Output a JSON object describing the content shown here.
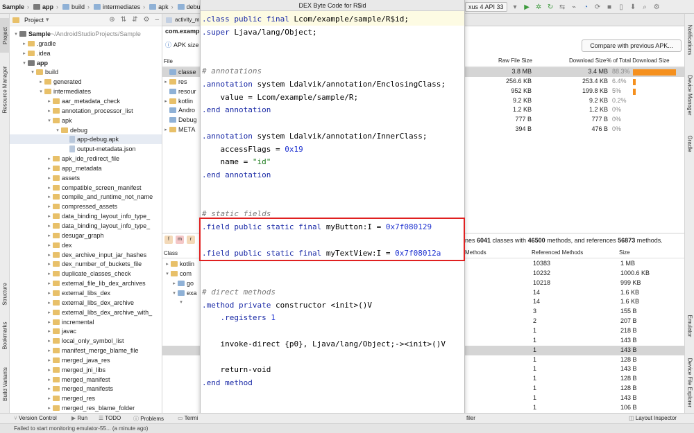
{
  "topbar": {
    "crumbs": [
      "Sample",
      "app",
      "build",
      "intermediates",
      "apk",
      "debug",
      "app-debug"
    ],
    "device": "xus 4 API 33"
  },
  "left_strip": {
    "project": "Project",
    "resource_manager": "Resource Manager",
    "structure": "Structure",
    "bookmarks": "Bookmarks",
    "build_variants": "Build Variants"
  },
  "right_strip": {
    "notifications": "Notifications",
    "device_manager": "Device Manager",
    "gradle": "Gradle",
    "emulator": "Emulator",
    "device_file_explorer": "Device File Explorer"
  },
  "project_panel": {
    "title": "Project",
    "tree": [
      {
        "label": "Sample",
        "suffix": "~/AndroidStudioProjects/Sample",
        "depth": 0,
        "arrow": "▾",
        "icon": "folder-dark",
        "bold": true
      },
      {
        "label": ".gradle",
        "depth": 1,
        "arrow": "▸",
        "icon": "folder"
      },
      {
        "label": ".idea",
        "depth": 1,
        "arrow": "▸",
        "icon": "folder"
      },
      {
        "label": "app",
        "depth": 1,
        "arrow": "▾",
        "icon": "folder-dark",
        "bold": true
      },
      {
        "label": "build",
        "depth": 2,
        "arrow": "▾",
        "icon": "folder"
      },
      {
        "label": "generated",
        "depth": 3,
        "arrow": "▸",
        "icon": "folder"
      },
      {
        "label": "intermediates",
        "depth": 3,
        "arrow": "▾",
        "icon": "folder"
      },
      {
        "label": "aar_metadata_check",
        "depth": 4,
        "arrow": "▸",
        "icon": "folder"
      },
      {
        "label": "annotation_processor_list",
        "depth": 4,
        "arrow": "▸",
        "icon": "folder"
      },
      {
        "label": "apk",
        "depth": 4,
        "arrow": "▾",
        "icon": "folder"
      },
      {
        "label": "debug",
        "depth": 5,
        "arrow": "▾",
        "icon": "folder"
      },
      {
        "label": "app-debug.apk",
        "depth": 6,
        "arrow": "",
        "icon": "file",
        "hl": true
      },
      {
        "label": "output-metadata.json",
        "depth": 6,
        "arrow": "",
        "icon": "file"
      },
      {
        "label": "apk_ide_redirect_file",
        "depth": 4,
        "arrow": "▸",
        "icon": "folder"
      },
      {
        "label": "app_metadata",
        "depth": 4,
        "arrow": "▸",
        "icon": "folder"
      },
      {
        "label": "assets",
        "depth": 4,
        "arrow": "▸",
        "icon": "folder"
      },
      {
        "label": "compatible_screen_manifest",
        "depth": 4,
        "arrow": "▸",
        "icon": "folder"
      },
      {
        "label": "compile_and_runtime_not_name",
        "depth": 4,
        "arrow": "▸",
        "icon": "folder"
      },
      {
        "label": "compressed_assets",
        "depth": 4,
        "arrow": "▸",
        "icon": "folder"
      },
      {
        "label": "data_binding_layout_info_type_",
        "depth": 4,
        "arrow": "▸",
        "icon": "folder"
      },
      {
        "label": "data_binding_layout_info_type_",
        "depth": 4,
        "arrow": "▸",
        "icon": "folder"
      },
      {
        "label": "desugar_graph",
        "depth": 4,
        "arrow": "▸",
        "icon": "folder"
      },
      {
        "label": "dex",
        "depth": 4,
        "arrow": "▸",
        "icon": "folder"
      },
      {
        "label": "dex_archive_input_jar_hashes",
        "depth": 4,
        "arrow": "▸",
        "icon": "folder"
      },
      {
        "label": "dex_number_of_buckets_file",
        "depth": 4,
        "arrow": "▸",
        "icon": "folder"
      },
      {
        "label": "duplicate_classes_check",
        "depth": 4,
        "arrow": "▸",
        "icon": "folder"
      },
      {
        "label": "external_file_lib_dex_archives",
        "depth": 4,
        "arrow": "▸",
        "icon": "folder"
      },
      {
        "label": "external_libs_dex",
        "depth": 4,
        "arrow": "▸",
        "icon": "folder"
      },
      {
        "label": "external_libs_dex_archive",
        "depth": 4,
        "arrow": "▸",
        "icon": "folder"
      },
      {
        "label": "external_libs_dex_archive_with_",
        "depth": 4,
        "arrow": "▸",
        "icon": "folder"
      },
      {
        "label": "incremental",
        "depth": 4,
        "arrow": "▸",
        "icon": "folder"
      },
      {
        "label": "javac",
        "depth": 4,
        "arrow": "▸",
        "icon": "folder"
      },
      {
        "label": "local_only_symbol_list",
        "depth": 4,
        "arrow": "▸",
        "icon": "folder"
      },
      {
        "label": "manifest_merge_blame_file",
        "depth": 4,
        "arrow": "▸",
        "icon": "folder"
      },
      {
        "label": "merged_java_res",
        "depth": 4,
        "arrow": "▸",
        "icon": "folder"
      },
      {
        "label": "merged_jni_libs",
        "depth": 4,
        "arrow": "▸",
        "icon": "folder"
      },
      {
        "label": "merged_manifest",
        "depth": 4,
        "arrow": "▸",
        "icon": "folder"
      },
      {
        "label": "merged_manifests",
        "depth": 4,
        "arrow": "▸",
        "icon": "folder"
      },
      {
        "label": "merged_res",
        "depth": 4,
        "arrow": "▸",
        "icon": "folder"
      },
      {
        "label": "merged_res_blame_folder",
        "depth": 4,
        "arrow": "▸",
        "icon": "folder"
      }
    ]
  },
  "analyzer": {
    "tabs": [
      "activity_m",
      "app-debug"
    ],
    "package": "com.examp",
    "apk_size_label": "APK size",
    "file_col": "File",
    "file_rows": [
      {
        "label": "classe",
        "arrow": "",
        "sel": true
      },
      {
        "label": "res",
        "arrow": "▸"
      },
      {
        "label": "resour",
        "arrow": ""
      },
      {
        "label": "kotlin",
        "arrow": "▸"
      },
      {
        "label": "Andro",
        "arrow": ""
      },
      {
        "label": "Debug",
        "arrow": ""
      },
      {
        "label": "META",
        "arrow": "▸"
      }
    ],
    "compare_button": "Compare with previous APK...",
    "size_headers": {
      "raw": "Raw File Size",
      "download": "Download Size",
      "pct": "% of Total Download Size"
    },
    "size_rows": [
      {
        "raw": "3.8 MB",
        "download": "3.4 MB",
        "pct": "88.3%",
        "bar": 0.883,
        "sel": true
      },
      {
        "raw": "256.6 KB",
        "download": "253.4 KB",
        "pct": "6.4%",
        "bar": 0.064
      },
      {
        "raw": "952 KB",
        "download": "199.8 KB",
        "pct": "5%",
        "bar": 0.05
      },
      {
        "raw": "9.2 KB",
        "download": "9.2 KB",
        "pct": "0.2%",
        "bar": 0
      },
      {
        "raw": "1.2 KB",
        "download": "1.2 KB",
        "pct": "0%",
        "bar": 0
      },
      {
        "raw": "777 B",
        "download": "777 B",
        "pct": "0%",
        "bar": 0
      },
      {
        "raw": "394 B",
        "download": "476 B",
        "pct": "0%",
        "bar": 0
      }
    ],
    "summary": {
      "p1": "nes ",
      "classes": "6041",
      "p2": " classes with ",
      "methods": "46500",
      "p3": " methods, and references ",
      "refs": "56873",
      "p4": " methods."
    },
    "class_col": "Class",
    "class_rows": [
      {
        "label": "kotlin",
        "arrow": "▸",
        "indent": 0
      },
      {
        "label": "com",
        "arrow": "▾",
        "indent": 0
      },
      {
        "label": "go",
        "arrow": "▸",
        "indent": 1
      },
      {
        "label": "exa",
        "arrow": "▾",
        "indent": 1
      },
      {
        "label": "",
        "arrow": "▾",
        "indent": 2
      },
      {
        "label": "",
        "arrow": "",
        "indent": 3
      },
      {
        "label": "",
        "arrow": "",
        "indent": 3
      },
      {
        "label": "",
        "arrow": "",
        "indent": 3
      },
      {
        "label": "",
        "arrow": "",
        "indent": 3
      },
      {
        "label": "",
        "arrow": "",
        "indent": 3
      },
      {
        "label": "",
        "arrow": "",
        "indent": 3
      },
      {
        "label": "",
        "arrow": "",
        "indent": 3
      },
      {
        "label": "",
        "arrow": "",
        "indent": 3
      },
      {
        "label": "",
        "arrow": "",
        "indent": 3
      },
      {
        "label": "",
        "arrow": "",
        "indent": 3
      },
      {
        "label": "",
        "arrow": "",
        "indent": 3
      }
    ],
    "method_headers": {
      "methods": "Methods",
      "ref": "Referenced Methods",
      "size": "Size"
    },
    "method_rows": [
      {
        "ref": "10383",
        "size": "1 MB"
      },
      {
        "ref": "10232",
        "size": "1000.6 KB"
      },
      {
        "ref": "10218",
        "size": "999 KB"
      },
      {
        "ref": "14",
        "size": "1.6 KB"
      },
      {
        "ref": "14",
        "size": "1.6 KB"
      },
      {
        "ref": "3",
        "size": "155 B"
      },
      {
        "ref": "2",
        "size": "207 B"
      },
      {
        "ref": "1",
        "size": "218 B"
      },
      {
        "ref": "1",
        "size": "143 B"
      },
      {
        "ref": "1",
        "size": "143 B",
        "sel": true
      },
      {
        "ref": "1",
        "size": "128 B"
      },
      {
        "ref": "1",
        "size": "143 B"
      },
      {
        "ref": "1",
        "size": "128 B"
      },
      {
        "ref": "1",
        "size": "128 B"
      },
      {
        "ref": "1",
        "size": "143 B"
      },
      {
        "ref": "1",
        "size": "106 B"
      }
    ]
  },
  "dialog": {
    "title": "DEX Byte Code for R$id",
    "lines": [
      [
        [
          "kw",
          ".class public final "
        ],
        [
          "",
          "Lcom/example/sample/R$id;"
        ]
      ],
      [
        [
          "kw",
          ".super "
        ],
        [
          "",
          "Ljava/lang/Object;"
        ]
      ],
      [],
      [],
      [
        [
          "cm",
          "# annotations"
        ]
      ],
      [
        [
          "kw",
          ".annotation "
        ],
        [
          "",
          "system Ldalvik/annotation/EnclosingClass;"
        ]
      ],
      [
        [
          "",
          "    value = Lcom/example/sample/R;"
        ]
      ],
      [
        [
          "kw",
          ".end annotation"
        ]
      ],
      [],
      [
        [
          "kw",
          ".annotation "
        ],
        [
          "",
          "system Ldalvik/annotation/InnerClass;"
        ]
      ],
      [
        [
          "",
          "    accessFlags = "
        ],
        [
          "nm",
          "0x19"
        ]
      ],
      [
        [
          "",
          "    name = "
        ],
        [
          "st",
          "\"id\""
        ]
      ],
      [
        [
          "kw",
          ".end annotation"
        ]
      ],
      [],
      [],
      [
        [
          "cm",
          "# static fields"
        ]
      ],
      [
        [
          "kw",
          ".field public static final "
        ],
        [
          "",
          "myButton:I = "
        ],
        [
          "nm",
          "0x7f080129"
        ]
      ],
      [],
      [
        [
          "kw",
          ".field public static final "
        ],
        [
          "",
          "myTextView:I = "
        ],
        [
          "nm",
          "0x7f08012a"
        ]
      ],
      [],
      [],
      [
        [
          "cm",
          "# direct methods"
        ]
      ],
      [
        [
          "kw",
          ".method private "
        ],
        [
          "",
          "constructor <init>()V"
        ]
      ],
      [
        [
          "kw",
          "    .registers "
        ],
        [
          "nm",
          "1"
        ]
      ],
      [],
      [
        [
          "",
          "    invoke-direct {p0}, Ljava/lang/Object;-><init>()V"
        ]
      ],
      [],
      [
        [
          "",
          "    return-void"
        ]
      ],
      [
        [
          "kw",
          ".end method"
        ]
      ]
    ]
  },
  "bottom_tools": {
    "version_control": "Version Control",
    "run": "Run",
    "todo": "TODO",
    "problems": "Problems",
    "terminal": "Termi",
    "profiler": "filer",
    "layout_inspector": "Layout Inspector"
  },
  "status": "Failed to start monitoring emulator-55... (a minute ago)",
  "colors": {
    "accent_bar": "#f5901e",
    "highlight_box": "#e02020",
    "keyword": "#1a2aa6",
    "number": "#1f33d0"
  }
}
